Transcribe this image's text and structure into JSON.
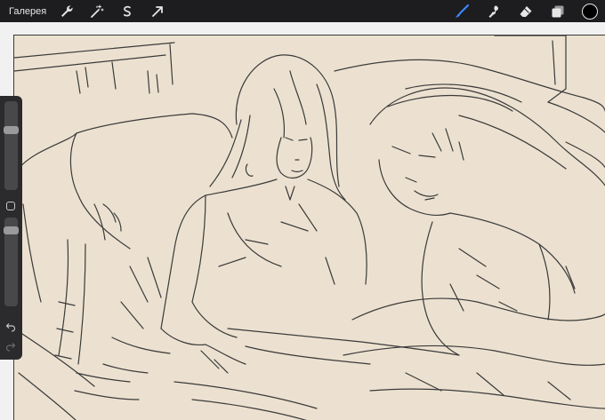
{
  "topbar": {
    "gallery_label": "Галерея",
    "left_tools": [
      {
        "icon": "wrench-icon"
      },
      {
        "icon": "magic-wand-icon"
      },
      {
        "icon": "selection-icon"
      },
      {
        "icon": "transform-arrow-icon"
      }
    ],
    "right_tools": [
      {
        "icon": "brush-icon"
      },
      {
        "icon": "smudge-icon"
      },
      {
        "icon": "eraser-icon"
      },
      {
        "icon": "layers-icon"
      }
    ],
    "current_color": "#000000",
    "brush_active_color": "#3b8cff"
  },
  "sidebar": {
    "size_slider_value": 0.2,
    "opacity_slider_value": 0.15,
    "modify_icon": "square-icon",
    "undo_icon": "undo-icon",
    "redo_icon": "redo-icon"
  },
  "canvas": {
    "paper_color": "#ece1d0",
    "line_color": "#3a3a3a"
  }
}
